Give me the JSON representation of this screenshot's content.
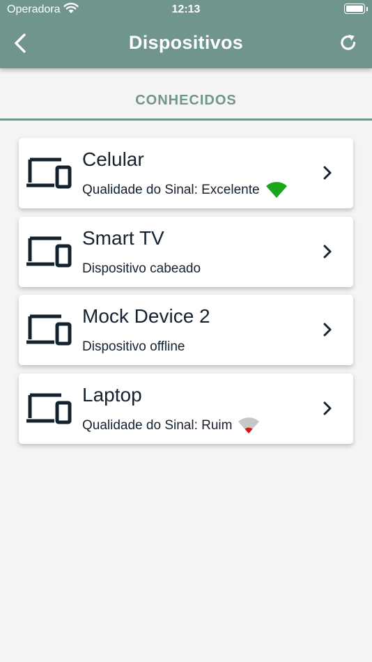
{
  "status_bar": {
    "carrier": "Operadora",
    "time": "12:13"
  },
  "header": {
    "title": "Dispositivos",
    "back_icon": "chevron-left-icon",
    "refresh_icon": "refresh-icon",
    "color": "#6f958c"
  },
  "section": {
    "label": "CONHECIDOS"
  },
  "devices": [
    {
      "name": "Celular",
      "status": "Qualidade do Sinal: Excelente",
      "signal": "excelente",
      "signal_color": "#1aa51a"
    },
    {
      "name": "Smart TV",
      "status": "Dispositivo cabeado",
      "signal": "none"
    },
    {
      "name": "Mock Device 2",
      "status": "Dispositivo offline",
      "signal": "none"
    },
    {
      "name": "Laptop",
      "status": "Qualidade do Sinal: Ruim",
      "signal": "ruim",
      "signal_color": "#d0181b"
    }
  ]
}
